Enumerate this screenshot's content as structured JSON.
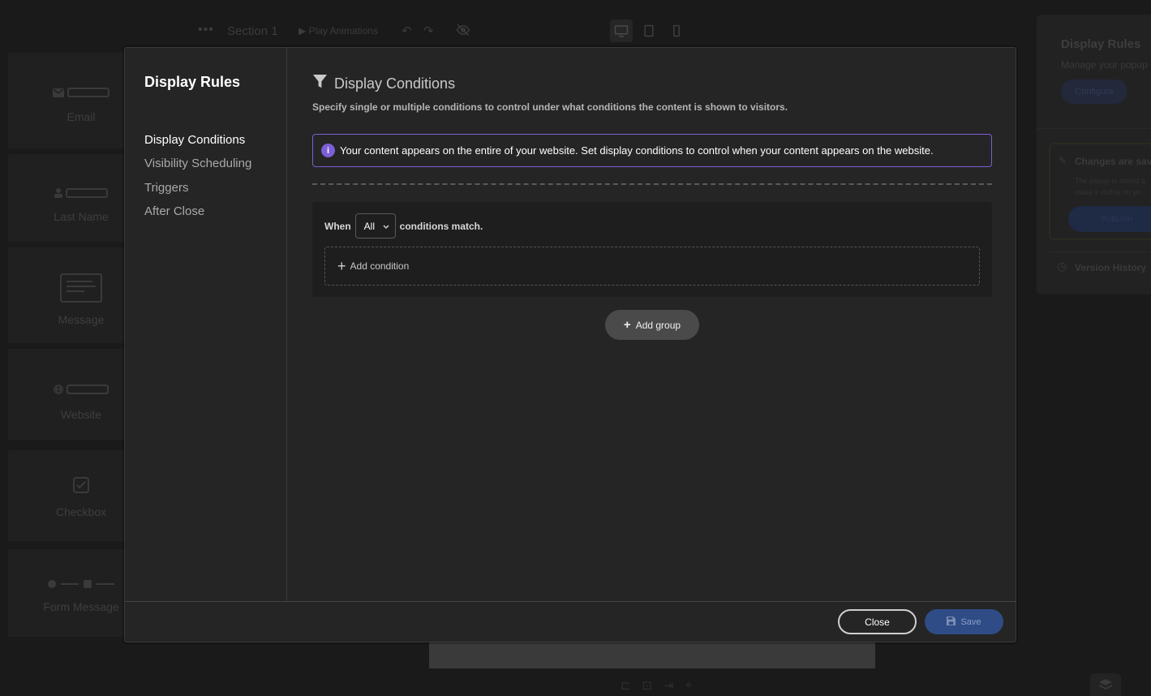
{
  "editor": {
    "section_name": "Section 1",
    "play_label": "Play Animations",
    "fields": [
      {
        "label": "Email",
        "icon": "email-icon"
      },
      {
        "label": "Last Name",
        "icon": "user-icon"
      },
      {
        "label": "Message",
        "icon": "textarea-icon"
      },
      {
        "label": "Website",
        "icon": "globe-icon"
      },
      {
        "label": "Checkbox",
        "icon": "checkbox-icon"
      },
      {
        "label": "Form Message",
        "icon": "form-message-icon"
      }
    ],
    "right_panel": {
      "title": "Display Rules",
      "subtitle": "Manage your popup",
      "configure_label": "Configure",
      "changes_title": "Changes are sav",
      "changes_desc_1": "The popup is stored a",
      "changes_desc_2": "make it visible on yo",
      "publish_label": "PUBLISH",
      "version_history": "Version History"
    }
  },
  "modal": {
    "title": "Display Rules",
    "nav": [
      {
        "label": "Display Conditions",
        "active": true
      },
      {
        "label": "Visibility Scheduling",
        "active": false
      },
      {
        "label": "Triggers",
        "active": false
      },
      {
        "label": "After Close",
        "active": false
      }
    ],
    "section_title": "Display Conditions",
    "description": "Specify single or multiple conditions to control under what conditions the content is shown to visitors.",
    "info_text": "Your content appears on the entire of your website. Set display conditions to control when your content appears on the website.",
    "group": {
      "when_label": "When",
      "match_value": "All",
      "match_suffix": "conditions match.",
      "add_condition_label": "Add condition"
    },
    "add_group_label": "Add group",
    "footer": {
      "close_label": "Close",
      "save_label": "Save"
    }
  },
  "colors": {
    "accent": "#7b5fd6",
    "save_button": "#2f4c86",
    "modal_bg": "#252525"
  }
}
